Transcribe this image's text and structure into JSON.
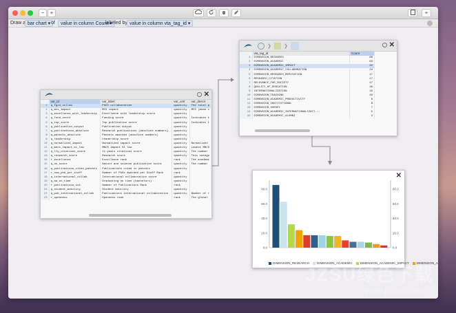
{
  "toolbar": {
    "zoom_out": "−",
    "zoom_in": "+",
    "add_label": "+"
  },
  "query": {
    "draw": "Draw a",
    "chart": "bar chart",
    "of": "of",
    "value": "value in column Count",
    "labeled_by": "labeled by",
    "label": "value in column vta_tag_id"
  },
  "table1": {
    "headers": [
      "var_id",
      "var_label",
      "var_unit",
      "var_descri"
    ],
    "rows": [
      [
        "q_fgzd_collab",
        "FGCD collaboration",
        "quantity",
        "The total p"
      ],
      [
        "q_mcs_impact",
        "MCS impact",
        "quantity",
        "MCS (mean c"
      ],
      [
        "q_excellence_with_leadership",
        "Excellence with leadership score",
        "quantity",
        ""
      ],
      [
        "q_fund_score",
        "Funding score",
        "quantity",
        "Indicates t"
      ],
      [
        "q_top_score",
        "Top publication score",
        "quantity",
        "Indicates t"
      ],
      [
        "q_publication_output",
        "Publication output",
        "quantity",
        ""
      ],
      [
        "q_publications_absolute",
        "Research publications (absolute numbers)",
        "quantity",
        ""
      ],
      [
        "q_patents_absolute",
        "Patents awarded (absolute numbers)",
        "quantity",
        ""
      ],
      [
        "q_leadership",
        "Leadership score",
        "quantity",
        ""
      ],
      [
        "q_normalized_impact",
        "Normalized impact score",
        "quantity",
        "Normalized"
      ],
      [
        "q_mncs_impact_si_low",
        "MNCS impact SI low",
        "quantity",
        "Lowest MNCS"
      ],
      [
        "q_lly_citations_score",
        "11 years citations score",
        "quantity",
        "The number"
      ],
      [
        "q_research_score",
        "Research score",
        "quantity",
        "This catego"
      ],
      [
        "r_excellence",
        "Excellence rank",
        "rank",
        "The academi"
      ],
      [
        "q_ns_score",
        "Nature and science publication score",
        "quantity",
        "The number"
      ],
      [
        "q_publications_cited_patents",
        "Publications cited in patents",
        "quantity",
        ""
      ],
      [
        "r_num_phd_per_staff",
        "Number of PhDs Awarded per Staff Rank",
        "rank",
        ""
      ],
      [
        "q_international_collab",
        "International collaboration score",
        "quantity",
        ""
      ],
      [
        "q_ba_on_time",
        "Graduating on time (bachelors)",
        "quantity",
        ""
      ],
      [
        "r_publications_sss",
        "Number of Publications Rank",
        "rank",
        ""
      ],
      [
        "q_student_mobility",
        "Student mobility",
        "quantity",
        ""
      ],
      [
        "q_pub_international_collab",
        "Publications international collaboration",
        "quantity",
        "Number of r"
      ],
      [
        "r_openness",
        "Openness rank",
        "rank",
        "The global"
      ]
    ]
  },
  "table2": {
    "headers": [
      "vta_tag_id",
      "Count"
    ],
    "rows": [
      [
        "DIMENSION_RESEARCH",
        "86"
      ],
      [
        "DIMENSION_ACADEMIC",
        "63"
      ],
      [
        "DIMENSION_ACADEMIC_IMPACT",
        "32"
      ],
      [
        "DIMENSION_ACADEMIC_COLLABORATION",
        "24"
      ],
      [
        "DIMENSION_RESEARCH_REPUTATION",
        "17"
      ],
      [
        "RESEARCH_CITATION",
        "17"
      ],
      [
        "RELEVANCE_FOR_SOCIETY",
        "17"
      ],
      [
        "QUALITY_OF_EDUCATION",
        "16"
      ],
      [
        "INTERNATIONALIZATION",
        "16"
      ],
      [
        "DIMENSION_TEACHING",
        "10"
      ],
      [
        "DIMENSION_ACADEMIC_PRODUCTIVITY",
        "8"
      ],
      [
        "DIMENSION_INSTITUTIONAL",
        "8"
      ],
      [
        "DIMENSION_SURVEY",
        "7"
      ],
      [
        "DIMENSION_ACADEMIC_INTERNATIONALIZATI...",
        "5"
      ],
      [
        "DIMENSION_ACADEMIC_ALUMNI",
        "3"
      ]
    ]
  },
  "chart_data": {
    "type": "bar",
    "categories": [
      "DIMENSION_RESEARCH",
      "DIMENSION_ACADEMIC",
      "DIMENSION_ACADEMIC_IMPACT",
      "DIMENSION_ACADEMIC_COLLABORATION",
      "DIMENSION_RESEARCH_REPUTATION",
      "RESEARCH_CITATION",
      "RELEVANCE_FOR_SOCIETY",
      "QUALITY_OF_EDUCATION",
      "INTERNATIONALIZATION",
      "DIMENSION_TEACHING",
      "DIMENSION_ACADEMIC_PRODUCTIVITY",
      "DIMENSION_INSTITUTIONAL",
      "DIMENSION_SURVEY",
      "DIMENSION_ACADEMIC_INTERNATIONALIZATION",
      "DIMENSION_ACADEMIC_ALUMNI"
    ],
    "values": [
      86,
      63,
      32,
      24,
      17,
      17,
      17,
      16,
      16,
      10,
      8,
      8,
      7,
      5,
      3
    ],
    "colors": [
      "#1f4e79",
      "#c9e4ef",
      "#b5d84b",
      "#f0a500",
      "#e03a2b",
      "#2f5f8a",
      "#9fd4e6",
      "#8ec63f",
      "#f5b32c",
      "#e8402c",
      "#4a6f95",
      "#a9d3e8",
      "#7fb54a",
      "#f39a1f",
      "#d9362a"
    ],
    "ylim": [
      0,
      86
    ],
    "yticks": [
      "0.0",
      "20.0",
      "40.0",
      "60.0",
      "80.0"
    ],
    "legend": [
      "DIMENSION_RESEARCH",
      "DIMENSION_ACADEMIC",
      "DIMENSION_ACADEMIC_IMPACT",
      "DIMENSION_A"
    ],
    "legend_placement": "bottom"
  },
  "watermark": {
    "line1": "JZSU绿色下载",
    "line2": "www.jz5u.com"
  }
}
